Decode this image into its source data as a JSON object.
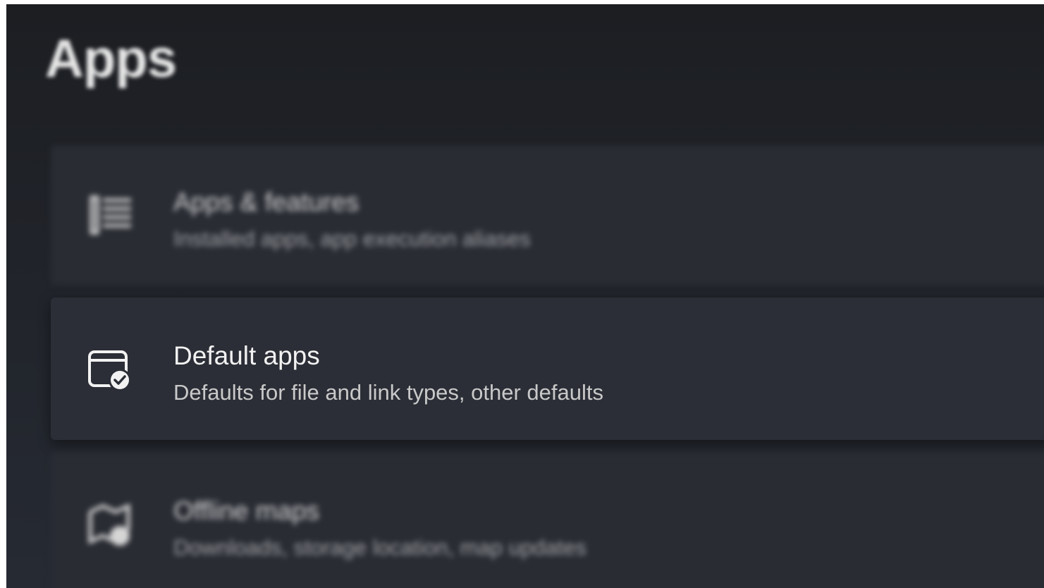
{
  "page": {
    "title": "Apps"
  },
  "cards": [
    {
      "title": "Apps & features",
      "subtitle": "Installed apps, app execution aliases",
      "icon": "list-icon"
    },
    {
      "title": "Default apps",
      "subtitle": "Defaults for file and link types, other defaults",
      "icon": "default-apps-icon"
    },
    {
      "title": "Offline maps",
      "subtitle": "Downloads, storage location, map updates",
      "icon": "offline-maps-icon"
    }
  ],
  "colors": {
    "background": "#202329",
    "card": "#2b2e36",
    "text_primary": "#f2f2f2",
    "text_secondary": "#c9c9c9"
  }
}
